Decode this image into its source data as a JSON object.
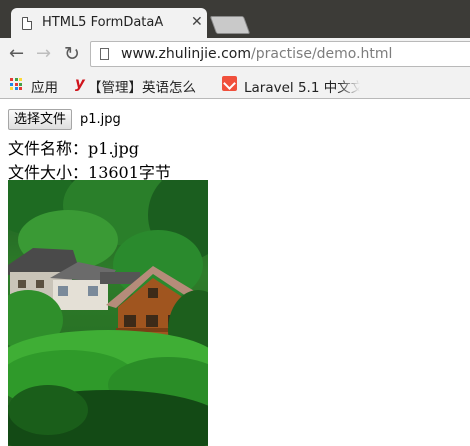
{
  "browser": {
    "tab_title": "HTML5 FormDataA",
    "url_host": "www.zhulinjie.com",
    "url_path": "/practise/demo.html",
    "bookmarks": {
      "apps_label": "应用",
      "manage_label": "【管理】英语怎么",
      "laravel_label": "Laravel 5.1 中文文"
    }
  },
  "page": {
    "file_button_label": "选择文件",
    "selected_file": "p1.jpg",
    "file_name_label": "文件名称：",
    "file_name_value": "p1.jpg",
    "file_size_label": "文件大小：",
    "file_size_value": "13601字节"
  }
}
